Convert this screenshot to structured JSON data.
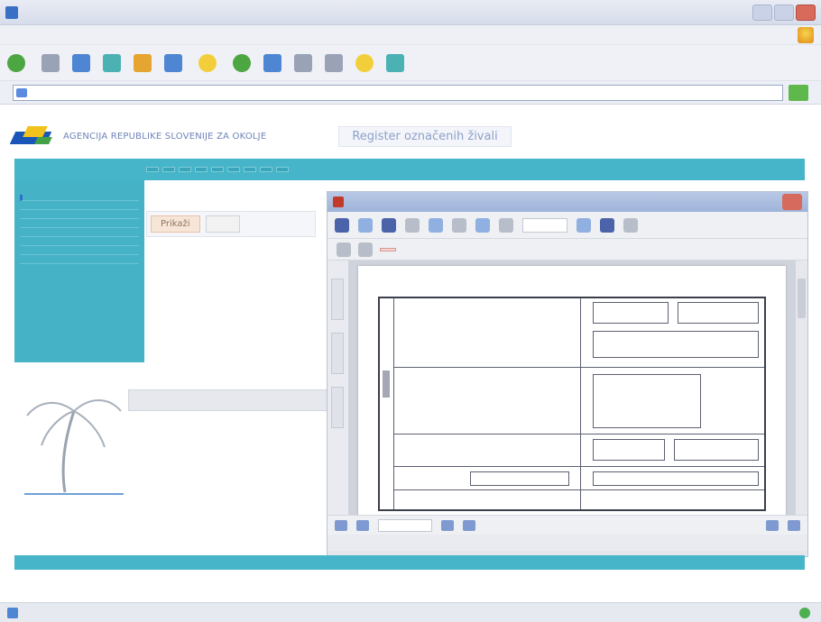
{
  "browser": {
    "title": "",
    "menu": [
      "",
      "",
      "",
      "",
      "",
      ""
    ],
    "toolbar": {
      "back_label": "",
      "search_label": "",
      "favorites_label": ""
    },
    "address": {
      "label": "",
      "url": "",
      "links_label": ""
    },
    "status": {
      "text": "",
      "zone": ""
    }
  },
  "site": {
    "agency": "AGENCIJA REPUBLIKE SLOVENIJE ZA OKOLJE",
    "register_title": "Register označenih živali",
    "nav": [
      "",
      "",
      "",
      "",
      "",
      "",
      "",
      "",
      "",
      ""
    ],
    "sidebar": {
      "heading": "",
      "items": [
        "",
        "",
        "",
        "",
        "",
        "",
        "",
        ""
      ]
    },
    "center": {
      "title": "",
      "buttons": [
        "Prikaži",
        ""
      ],
      "note": ""
    },
    "strip_label": "",
    "footer_left": "",
    "footer_right": "",
    "footer_text": ""
  },
  "pdf": {
    "title": "",
    "search_button": "",
    "status": "",
    "doc_heading": ""
  },
  "colors": {
    "nav_teal": "#47b5c9",
    "logo_blue": "#1a56b8",
    "logo_yellow": "#f0c21b",
    "logo_green": "#43a047"
  }
}
